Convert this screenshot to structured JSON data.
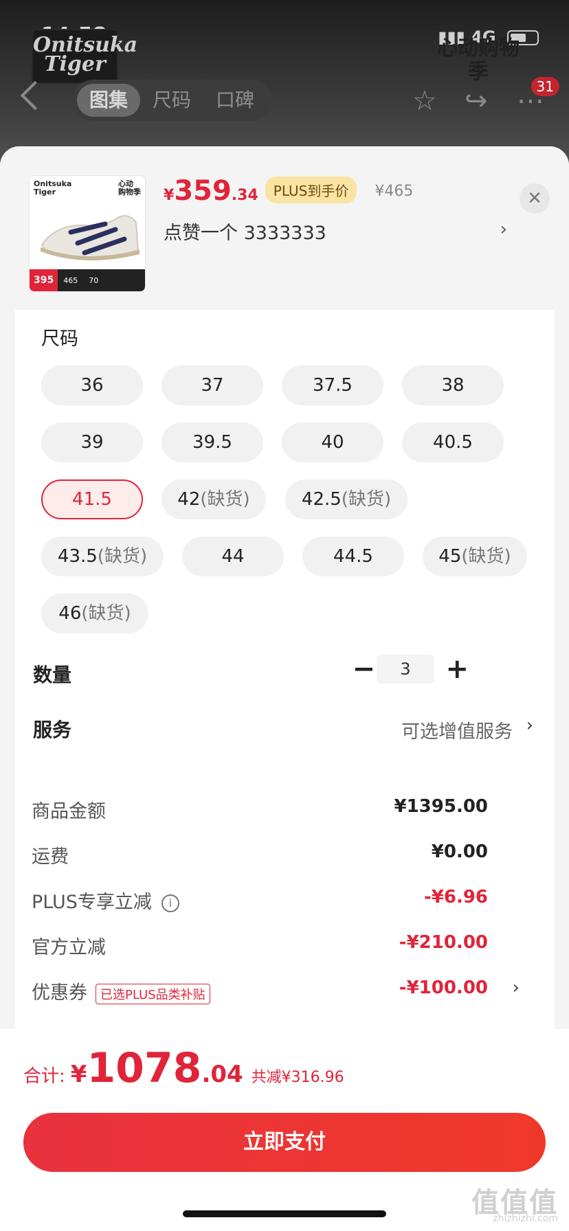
{
  "status": {
    "time": "14:58",
    "network": "4G"
  },
  "background": {
    "brand_logo": "Onitsuka Tiger",
    "promo_logo": "心动购物季",
    "tabs": [
      "图集",
      "尺码",
      "口碑"
    ],
    "cart_badge": "31"
  },
  "product": {
    "thumbnail": {
      "brand_left": "Onitsuka Tiger",
      "brand_right": "心动购物季",
      "price_tag": "395",
      "orig": "465",
      "off": "70"
    },
    "price_symbol": "¥",
    "price_int": "359",
    "price_dec": ".34",
    "plus_tag": "PLUS到手价",
    "original_price": "¥465",
    "variant": "点赞一个  3333333"
  },
  "sizes": {
    "title": "尺码",
    "oos_text": "(缺货)",
    "items": [
      {
        "size": "36",
        "oos": false
      },
      {
        "size": "37",
        "oos": false
      },
      {
        "size": "37.5",
        "oos": false
      },
      {
        "size": "38",
        "oos": false
      },
      {
        "size": "39",
        "oos": false
      },
      {
        "size": "39.5",
        "oos": false
      },
      {
        "size": "40",
        "oos": false
      },
      {
        "size": "40.5",
        "oos": false
      },
      {
        "size": "41.5",
        "oos": false,
        "selected": true
      },
      {
        "size": "42",
        "oos": true
      },
      {
        "size": "42.5",
        "oos": true
      },
      {
        "size": "43.5",
        "oos": true
      },
      {
        "size": "44",
        "oos": false
      },
      {
        "size": "44.5",
        "oos": false
      },
      {
        "size": "45",
        "oos": true
      },
      {
        "size": "46",
        "oos": true
      }
    ]
  },
  "quantity": {
    "label": "数量",
    "value": "3",
    "minus": "−",
    "plus": "+"
  },
  "service": {
    "label": "服务",
    "value": "可选增值服务"
  },
  "summary": {
    "goods_label": "商品金额",
    "goods_value": "¥1395.00",
    "shipping_label": "运费",
    "shipping_value": "¥0.00",
    "plus_label": "PLUS专享立减",
    "plus_value": "-¥6.96",
    "official_label": "官方立减",
    "official_value": "-¥210.00",
    "coupon_label": "优惠券",
    "coupon_tag": "已选PLUS品类补贴",
    "coupon_value": "-¥100.00"
  },
  "total": {
    "label": "合计:",
    "symbol": "¥",
    "int": "1078",
    "dec": ".04",
    "discount": "共减¥316.96"
  },
  "pay_button": "立即支付",
  "watermark": {
    "main": "值值值",
    "sub": "zhizhizhi.com"
  },
  "colors": {
    "accent": "#e0243a",
    "plus_tag_bg": "#fbe3a3"
  },
  "icons": [
    "back-icon",
    "star-icon",
    "share-icon",
    "more-icon",
    "close-icon",
    "chevron-right-icon",
    "info-icon"
  ]
}
